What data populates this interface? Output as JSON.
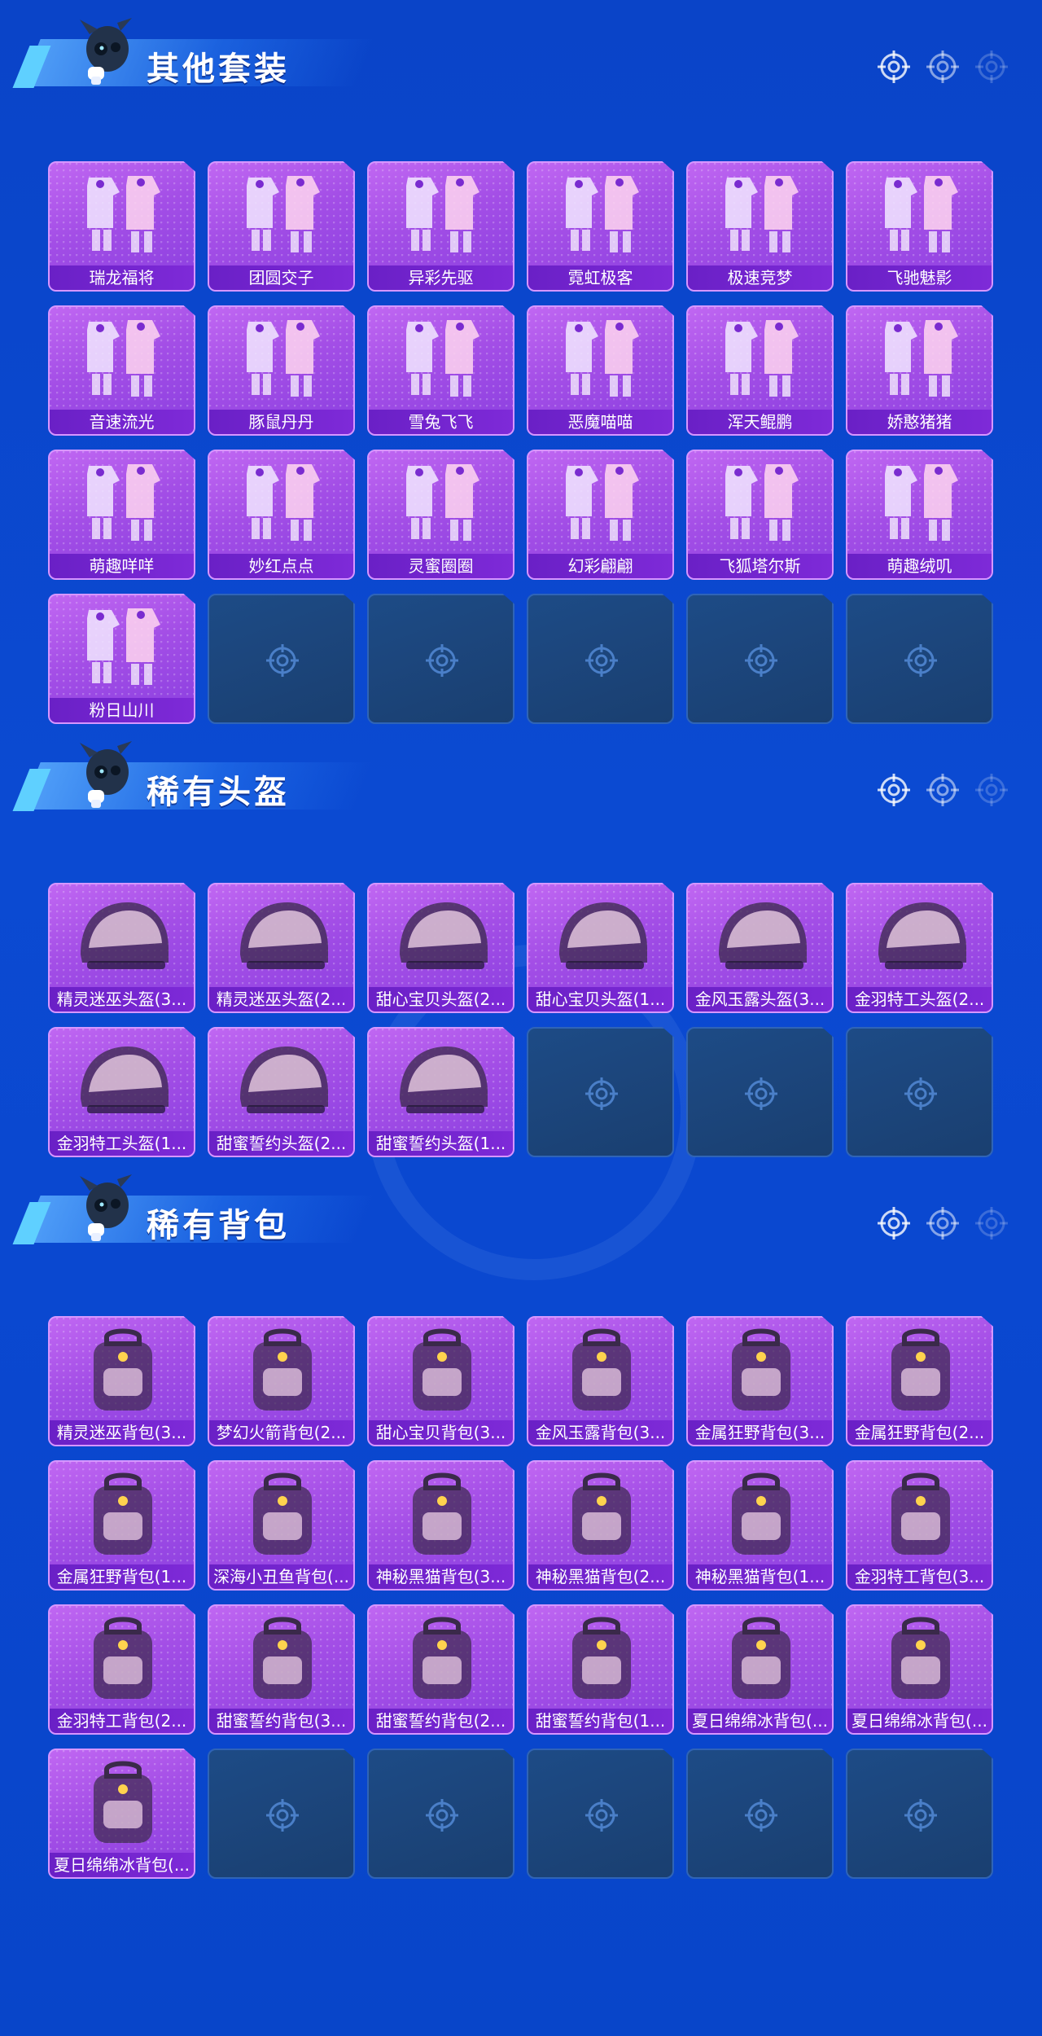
{
  "sections": [
    {
      "title": "其他套装",
      "items": [
        {
          "label": "瑞龙福将",
          "icon": "outfit-icon"
        },
        {
          "label": "团圆交子",
          "icon": "outfit-icon"
        },
        {
          "label": "异彩先驱",
          "icon": "outfit-icon"
        },
        {
          "label": "霓虹极客",
          "icon": "outfit-icon"
        },
        {
          "label": "极速竞梦",
          "icon": "outfit-icon"
        },
        {
          "label": "飞驰魅影",
          "icon": "outfit-icon"
        },
        {
          "label": "音速流光",
          "icon": "outfit-icon"
        },
        {
          "label": "豚鼠丹丹",
          "icon": "outfit-icon"
        },
        {
          "label": "雪兔飞飞",
          "icon": "outfit-icon"
        },
        {
          "label": "恶魔喵喵",
          "icon": "outfit-icon"
        },
        {
          "label": "浑天鲲鹏",
          "icon": "outfit-icon"
        },
        {
          "label": "娇憨猪猪",
          "icon": "outfit-icon"
        },
        {
          "label": "萌趣咩咩",
          "icon": "outfit-icon"
        },
        {
          "label": "妙红点点",
          "icon": "outfit-icon"
        },
        {
          "label": "灵蜜圈圈",
          "icon": "outfit-icon"
        },
        {
          "label": "幻彩翩翩",
          "icon": "outfit-icon"
        },
        {
          "label": "飞狐塔尔斯",
          "icon": "outfit-icon"
        },
        {
          "label": "萌趣绒叽",
          "icon": "outfit-icon"
        },
        {
          "label": "粉日山川",
          "icon": "outfit-icon"
        }
      ],
      "empty_slots": 5
    },
    {
      "title": "稀有头盔",
      "items": [
        {
          "label": "精灵迷巫头盔(3...",
          "icon": "helmet-icon"
        },
        {
          "label": "精灵迷巫头盔(2...",
          "icon": "helmet-icon"
        },
        {
          "label": "甜心宝贝头盔(2...",
          "icon": "helmet-icon"
        },
        {
          "label": "甜心宝贝头盔(1...",
          "icon": "helmet-icon"
        },
        {
          "label": "金风玉露头盔(3...",
          "icon": "helmet-icon"
        },
        {
          "label": "金羽特工头盔(2...",
          "icon": "helmet-icon"
        },
        {
          "label": "金羽特工头盔(1...",
          "icon": "helmet-icon"
        },
        {
          "label": "甜蜜誓约头盔(2...",
          "icon": "helmet-icon"
        },
        {
          "label": "甜蜜誓约头盔(1...",
          "icon": "helmet-icon"
        }
      ],
      "empty_slots": 3
    },
    {
      "title": "稀有背包",
      "items": [
        {
          "label": "精灵迷巫背包(3...",
          "icon": "backpack-icon"
        },
        {
          "label": "梦幻火箭背包(2...",
          "icon": "backpack-icon"
        },
        {
          "label": "甜心宝贝背包(3...",
          "icon": "backpack-icon"
        },
        {
          "label": "金风玉露背包(3...",
          "icon": "backpack-icon"
        },
        {
          "label": "金属狂野背包(3...",
          "icon": "backpack-icon"
        },
        {
          "label": "金属狂野背包(2...",
          "icon": "backpack-icon"
        },
        {
          "label": "金属狂野背包(1...",
          "icon": "backpack-icon"
        },
        {
          "label": "深海小丑鱼背包(...",
          "icon": "backpack-icon"
        },
        {
          "label": "神秘黑猫背包(3...",
          "icon": "backpack-icon"
        },
        {
          "label": "神秘黑猫背包(2...",
          "icon": "backpack-icon"
        },
        {
          "label": "神秘黑猫背包(1...",
          "icon": "backpack-icon"
        },
        {
          "label": "金羽特工背包(3...",
          "icon": "backpack-icon"
        },
        {
          "label": "金羽特工背包(2...",
          "icon": "backpack-icon"
        },
        {
          "label": "甜蜜誓约背包(3...",
          "icon": "backpack-icon"
        },
        {
          "label": "甜蜜誓约背包(2...",
          "icon": "backpack-icon"
        },
        {
          "label": "甜蜜誓约背包(1...",
          "icon": "backpack-icon"
        },
        {
          "label": "夏日绵绵冰背包(...",
          "icon": "backpack-icon"
        },
        {
          "label": "夏日绵绵冰背包(...",
          "icon": "backpack-icon"
        },
        {
          "label": "夏日绵绵冰背包(...",
          "icon": "backpack-icon"
        }
      ],
      "empty_slots": 5
    }
  ],
  "colors": {
    "background": "#0a47cf",
    "card_purple": "#a34ee6",
    "label_bar": "#7e2ad8",
    "empty_slot": "#1c4478"
  }
}
